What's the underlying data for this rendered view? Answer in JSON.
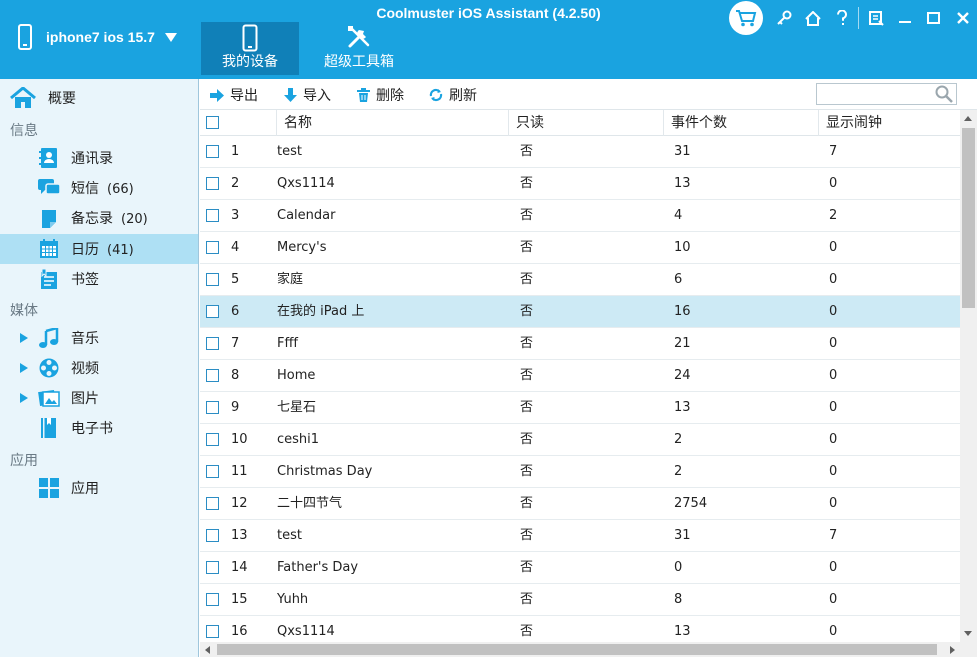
{
  "app": {
    "title": "Coolmuster iOS Assistant (4.2.50)",
    "device_name": "iphone7 ios 15.7"
  },
  "colors": {
    "brand": "#1aa3e0",
    "active_tab": "#1080b8",
    "sidebar_bg": "#e9f5fb",
    "selected": "#aee0f4"
  },
  "nav": {
    "my_device": "我的设备",
    "toolbox": "超级工具箱"
  },
  "sidebar": {
    "overview": "概要",
    "sections": {
      "info": "信息",
      "media": "媒体",
      "apps": "应用"
    },
    "contacts": {
      "label": "通讯录"
    },
    "sms": {
      "label": "短信",
      "count": "(66)"
    },
    "notes": {
      "label": "备忘录",
      "count": "(20)"
    },
    "calendar": {
      "label": "日历",
      "count": "(41)"
    },
    "bookmarks": {
      "label": "书签"
    },
    "music": {
      "label": "音乐"
    },
    "video": {
      "label": "视频"
    },
    "photos": {
      "label": "图片"
    },
    "ebooks": {
      "label": "电子书"
    },
    "app_item": {
      "label": "应用"
    }
  },
  "toolbar": {
    "export": "导出",
    "import": "导入",
    "delete": "删除",
    "refresh": "刷新",
    "search_placeholder": ""
  },
  "table": {
    "headers": {
      "name": "名称",
      "readonly": "只读",
      "events": "事件个数",
      "alarm": "显示闹钟"
    },
    "rows": [
      {
        "idx": "1",
        "name": "test",
        "readonly": "否",
        "events": "31",
        "alarm": "7"
      },
      {
        "idx": "2",
        "name": "Qxs1114",
        "readonly": "否",
        "events": "13",
        "alarm": "0"
      },
      {
        "idx": "3",
        "name": "Calendar",
        "readonly": "否",
        "events": "4",
        "alarm": "2"
      },
      {
        "idx": "4",
        "name": "Mercy's",
        "readonly": "否",
        "events": "10",
        "alarm": "0"
      },
      {
        "idx": "5",
        "name": "家庭",
        "readonly": "否",
        "events": "6",
        "alarm": "0"
      },
      {
        "idx": "6",
        "name": "在我的 iPad 上",
        "readonly": "否",
        "events": "16",
        "alarm": "0"
      },
      {
        "idx": "7",
        "name": "Ffff",
        "readonly": "否",
        "events": "21",
        "alarm": "0"
      },
      {
        "idx": "8",
        "name": "Home",
        "readonly": "否",
        "events": "24",
        "alarm": "0"
      },
      {
        "idx": "9",
        "name": "七星石",
        "readonly": "否",
        "events": "13",
        "alarm": "0"
      },
      {
        "idx": "10",
        "name": "ceshi1",
        "readonly": "否",
        "events": "2",
        "alarm": "0"
      },
      {
        "idx": "11",
        "name": "Christmas Day",
        "readonly": "否",
        "events": "2",
        "alarm": "0"
      },
      {
        "idx": "12",
        "name": "二十四节气",
        "readonly": "否",
        "events": "2754",
        "alarm": "0"
      },
      {
        "idx": "13",
        "name": "test",
        "readonly": "否",
        "events": "31",
        "alarm": "7"
      },
      {
        "idx": "14",
        "name": "Father's Day",
        "readonly": "否",
        "events": "0",
        "alarm": "0"
      },
      {
        "idx": "15",
        "name": "Yuhh",
        "readonly": "否",
        "events": "8",
        "alarm": "0"
      },
      {
        "idx": "16",
        "name": "Qxs1114",
        "readonly": "否",
        "events": "13",
        "alarm": "0"
      }
    ]
  }
}
